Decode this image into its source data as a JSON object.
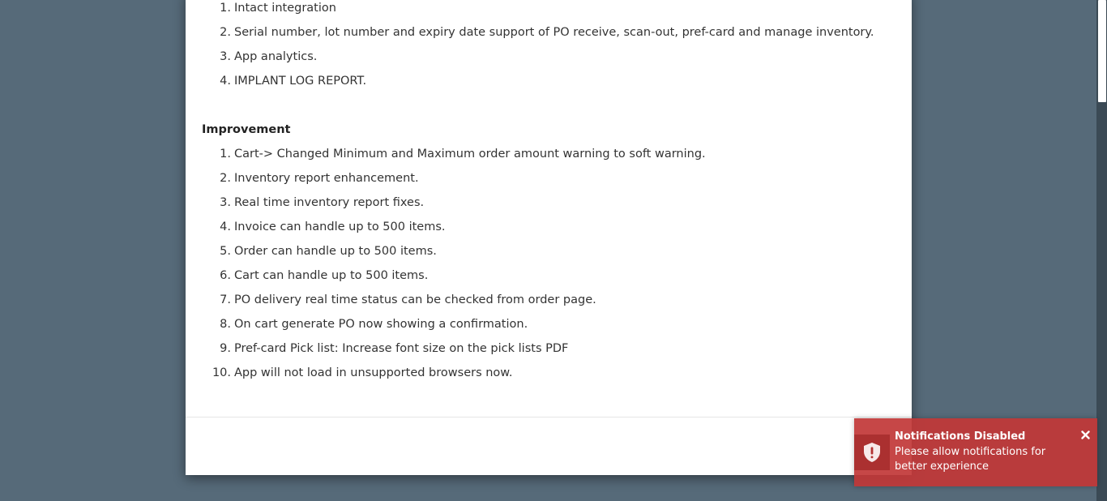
{
  "release_notes": {
    "features": [
      {
        "num": "1.",
        "text": "Intact integration"
      },
      {
        "num": "2.",
        "text": "Serial number, lot number and expiry date support of PO receive, scan-out, pref-card and manage inventory."
      },
      {
        "num": "3.",
        "text": "App analytics."
      },
      {
        "num": "4.",
        "text": "IMPLANT LOG REPORT."
      }
    ],
    "improvement_heading": "Improvement",
    "improvements": [
      {
        "num": "1.",
        "text": "Cart-> Changed Minimum and Maximum order amount warning to soft warning."
      },
      {
        "num": "2.",
        "text": "Inventory report enhancement."
      },
      {
        "num": "3.",
        "text": "Real time inventory report fixes."
      },
      {
        "num": "4.",
        "text": "Invoice can handle up to 500 items."
      },
      {
        "num": "5.",
        "text": "Order can handle up to 500 items."
      },
      {
        "num": "6.",
        "text": "Cart can handle up to 500 items."
      },
      {
        "num": "7.",
        "text": "PO delivery real time status can be checked from order page."
      },
      {
        "num": "8.",
        "text": "On cart generate PO now showing a confirmation."
      },
      {
        "num": "9.",
        "text": "Pref-card Pick list: Increase font size on the pick lists PDF"
      },
      {
        "num": "10.",
        "text": "App will not load in unsupported browsers now."
      }
    ]
  },
  "toast": {
    "title": "Notifications Disabled",
    "message": "Please allow notifications for better experience",
    "icon": "shield-alert-icon",
    "close_icon": "close-icon"
  },
  "colors": {
    "backdrop": "#566a79",
    "toast_bg": "#c13737"
  }
}
